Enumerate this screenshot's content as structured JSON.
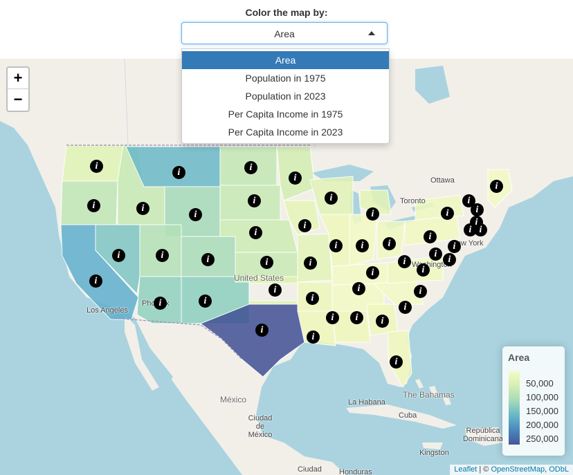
{
  "control": {
    "label": "Color the map by:",
    "selected": "Area",
    "options": [
      "Area",
      "Population in 1975",
      "Population in 2023",
      "Per Capita Income in 1975",
      "Per Capita Income in 2023"
    ]
  },
  "zoom": {
    "in_label": "+",
    "out_label": "−"
  },
  "legend": {
    "title": "Area",
    "ticks": [
      "50,000",
      "100,000",
      "150,000",
      "200,000",
      "250,000"
    ],
    "colors": [
      "#f5fbc8",
      "#d5eeb3",
      "#a7dab8",
      "#67b8c7",
      "#4a88bd",
      "#46569b"
    ]
  },
  "attribution": {
    "leaflet": "Leaflet",
    "separator": " | © ",
    "osm": "OpenStreetMap",
    "comma": ", ",
    "odbl": "ODbL"
  },
  "map_labels": {
    "ottawa": "Ottawa",
    "toronto": "Toronto",
    "new_york": "New York",
    "washington": "Washington",
    "phoenix": "Phoenix",
    "los_angeles": "Los Angeles",
    "united_states": "United States",
    "mexico": "México",
    "mexico_city": "Ciudad de México",
    "la_habana": "La Habana",
    "bahamas": "The Bahamas",
    "cuba": "Cuba",
    "kingston": "Kingston",
    "republica": "República Dominicana",
    "honduras": "Honduras",
    "ciudad": "Ciudad"
  },
  "marker_icon": "info-icon",
  "marker_glyph": "i"
}
